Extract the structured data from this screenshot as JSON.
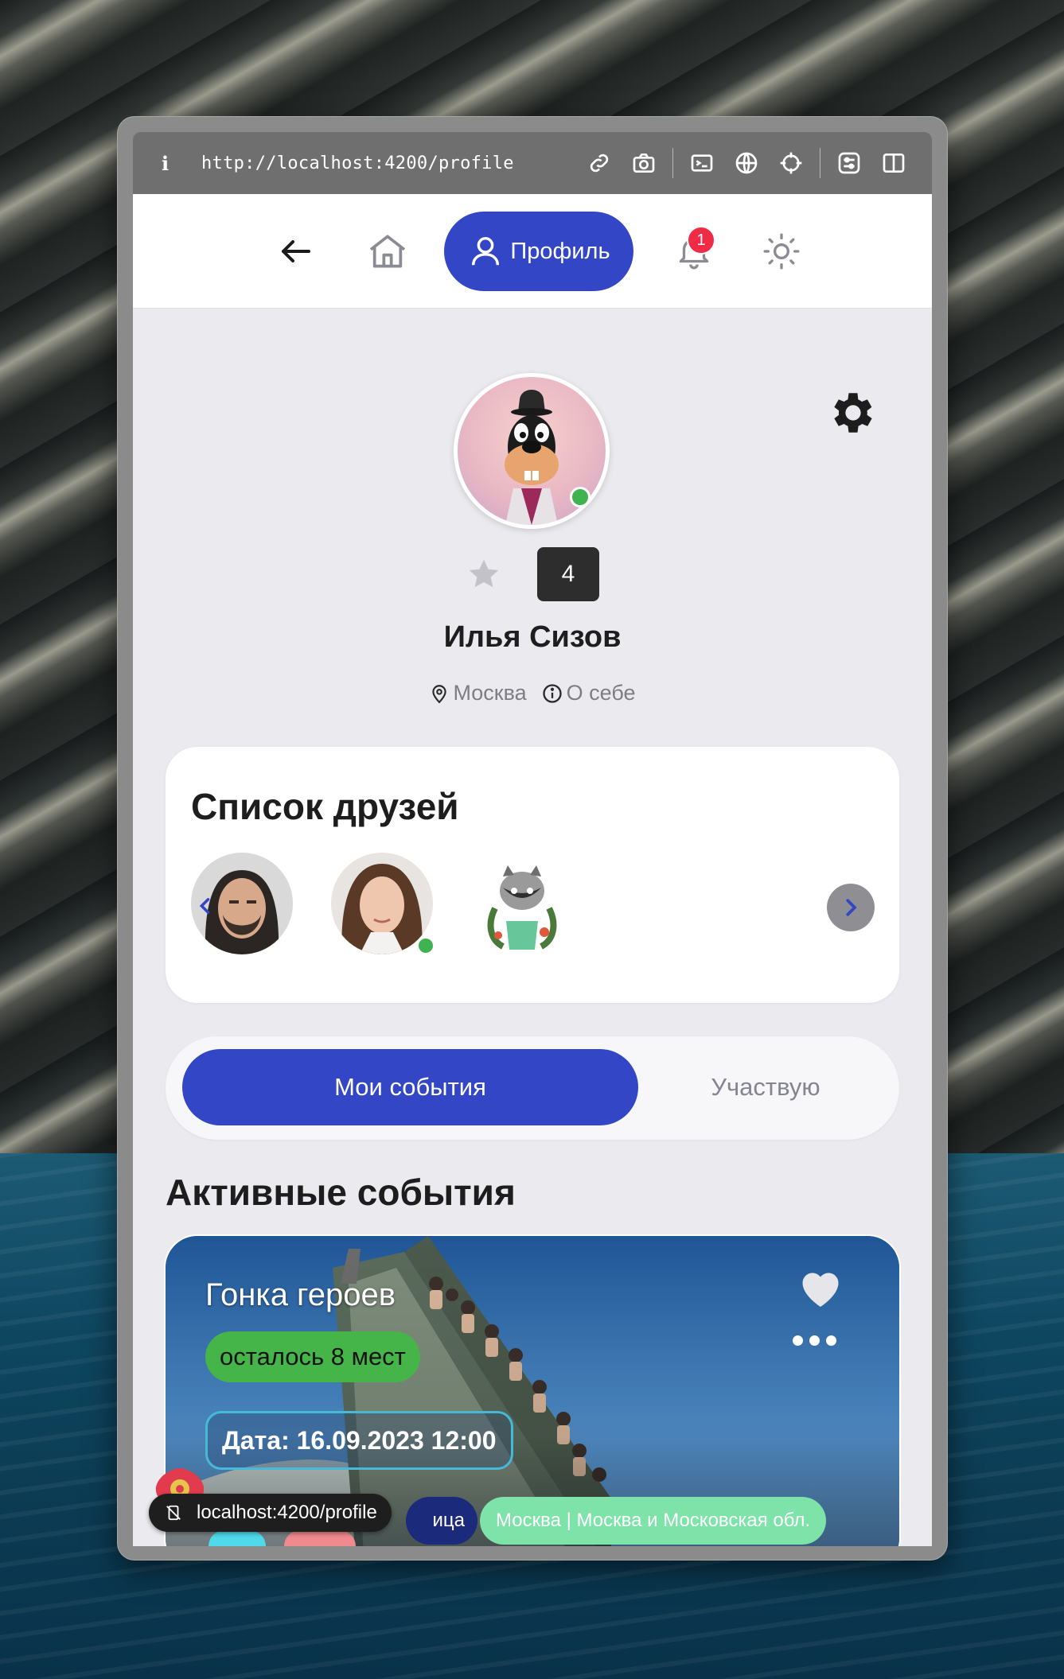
{
  "browser": {
    "info_glyph": "i",
    "url": "http://localhost:4200/profile",
    "toolbar_icons": [
      "link-icon",
      "camera-icon",
      "terminal-icon",
      "globe-icon",
      "crosshair-icon",
      "sliders-icon",
      "split-view-icon"
    ]
  },
  "nav": {
    "profile_label": "Профиль",
    "notification_count": "1"
  },
  "profile": {
    "rating": "4",
    "name": "Илья Сизов",
    "city": "Москва",
    "about": "О себе"
  },
  "friends": {
    "title": "Список друзей"
  },
  "tabs": {
    "active": "Мои события",
    "inactive": "Участвую"
  },
  "events": {
    "section_title": "Активные события",
    "items": [
      {
        "title": "Гонка героев",
        "seats": "осталось 8 мест",
        "date": "Дата: 16.09.2023 12:00",
        "category_fragment": "ица",
        "location": "Москва | Москва и Московская обл."
      }
    ]
  },
  "status_bar": {
    "url": "localhost:4200/profile"
  },
  "colors": {
    "accent": "#3246c6",
    "online": "#3fb34f",
    "badge": "#ef2b45",
    "seats": "#46b549",
    "location_tag": "#7ee3a8"
  }
}
